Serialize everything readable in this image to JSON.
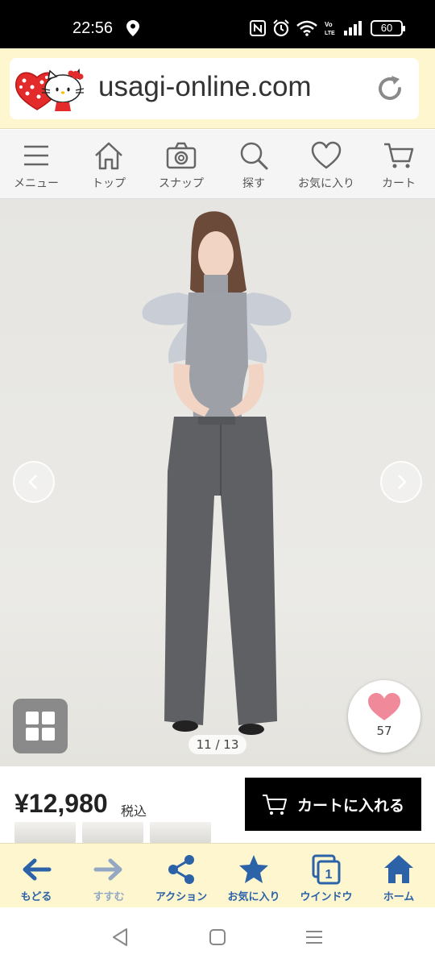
{
  "status_bar": {
    "time": "22:56",
    "battery": "60"
  },
  "address_bar": {
    "url": "usagi-online.com"
  },
  "site_nav": {
    "items": [
      {
        "label": "メニュー",
        "icon": "menu-icon"
      },
      {
        "label": "トップ",
        "icon": "home-outline-icon"
      },
      {
        "label": "スナップ",
        "icon": "camera-icon"
      },
      {
        "label": "探す",
        "icon": "search-icon"
      },
      {
        "label": "お気に入り",
        "icon": "heart-outline-icon"
      },
      {
        "label": "カート",
        "icon": "cart-icon"
      }
    ]
  },
  "product": {
    "pager": "11 / 13",
    "favorite_count": "57",
    "price": "¥12,980",
    "tax_label": "税込",
    "cart_button_label": "カートに入れる"
  },
  "browser_toolbar": {
    "items": [
      {
        "label": "もどる",
        "icon": "back-arrow-icon",
        "enabled": true
      },
      {
        "label": "すすむ",
        "icon": "forward-arrow-icon",
        "enabled": false
      },
      {
        "label": "アクション",
        "icon": "share-icon",
        "enabled": true
      },
      {
        "label": "お気に入り",
        "icon": "star-icon",
        "enabled": true
      },
      {
        "label": "ウインドウ",
        "icon": "window-icon",
        "enabled": true,
        "badge": "1"
      },
      {
        "label": "ホーム",
        "icon": "home-icon",
        "enabled": true
      }
    ]
  },
  "colors": {
    "toolbar_bg": "#fdf6cf",
    "toolbar_accent": "#2b62a8",
    "heart": "#f08a9a",
    "cart_button_bg": "#000000"
  }
}
